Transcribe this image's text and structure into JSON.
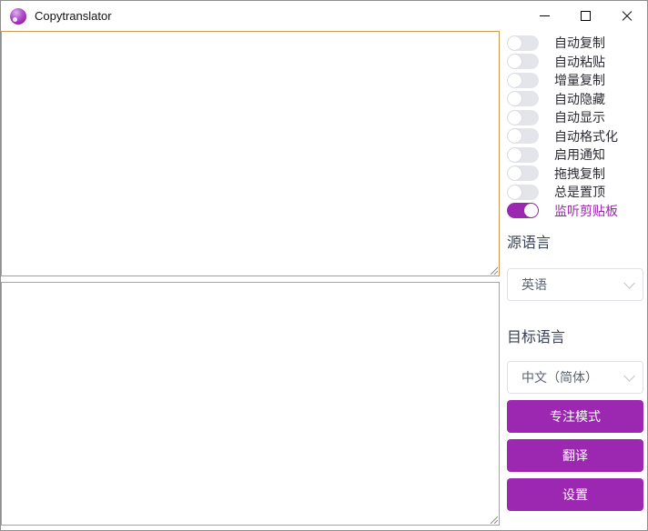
{
  "titlebar": {
    "title": "Copytranslator",
    "controls": {
      "minimize_icon": "minimize-icon",
      "maximize_icon": "maximize-icon",
      "close_icon": "close-icon"
    }
  },
  "editor": {
    "source_text": "",
    "source_placeholder": "",
    "result_text": "",
    "result_placeholder": ""
  },
  "settings": {
    "toggles": [
      {
        "label": "自动复制",
        "on": false
      },
      {
        "label": "自动粘贴",
        "on": false
      },
      {
        "label": "增量复制",
        "on": false
      },
      {
        "label": "自动隐藏",
        "on": false
      },
      {
        "label": "自动显示",
        "on": false
      },
      {
        "label": "自动格式化",
        "on": false
      },
      {
        "label": "启用通知",
        "on": false
      },
      {
        "label": "拖拽复制",
        "on": false
      },
      {
        "label": "总是置顶",
        "on": false
      },
      {
        "label": "监听剪贴板",
        "on": true
      }
    ]
  },
  "language": {
    "source": {
      "label": "源语言",
      "value": "英语"
    },
    "target": {
      "label": "目标语言",
      "value": "中文（简体）"
    }
  },
  "actions": [
    {
      "label": "专注模式"
    },
    {
      "label": "翻译"
    },
    {
      "label": "设置"
    }
  ],
  "colors": {
    "accent_purple": "#9c27b0",
    "focused_textarea_border": "#c79b52",
    "result_textarea_border": "#a3a3a6"
  }
}
